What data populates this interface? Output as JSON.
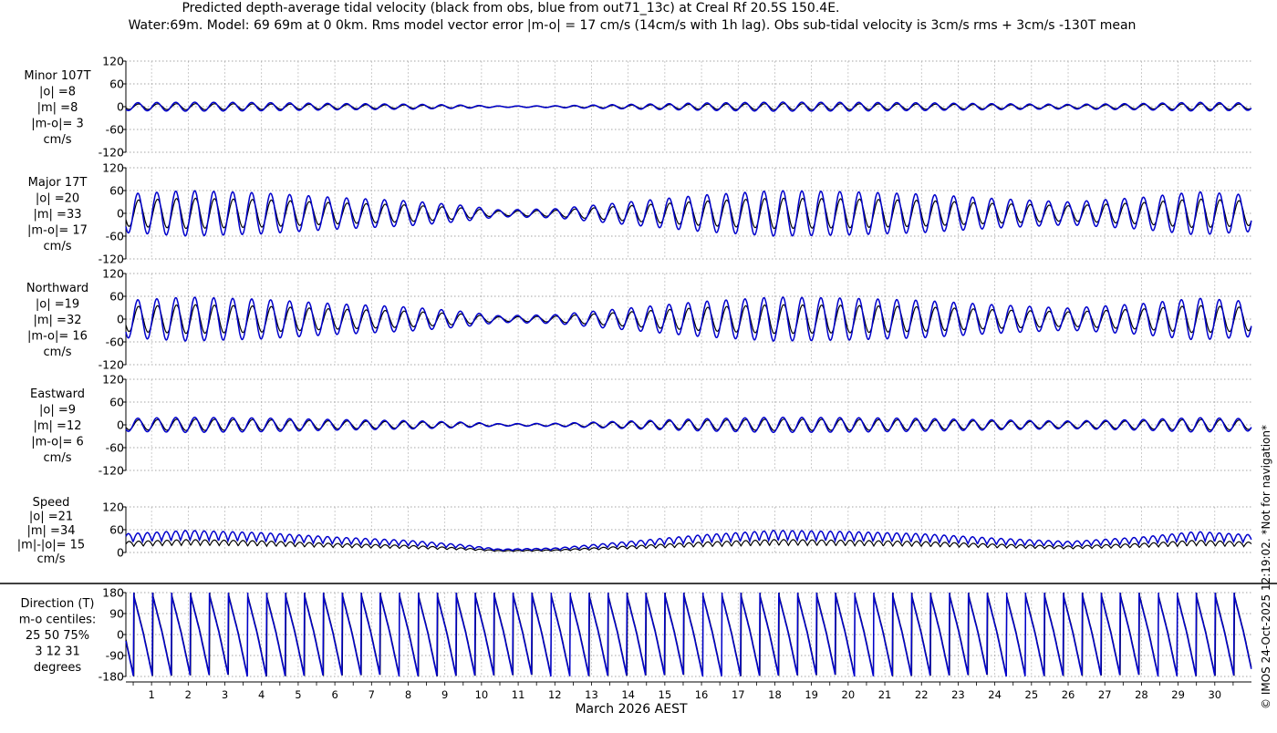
{
  "chart_data": {
    "type": "line",
    "title": "Predicted depth-average tidal velocity (black from obs, blue from out71_13c) at Creal Rf 20.5S 150.4E.",
    "subtitle": "Water:69m. Model: 69 69m at 0 0km. Rms model vector error |m-o| = 17 cm/s (14cm/s with 1h lag). Obs sub-tidal velocity is 3cm/s rms + 3cm/s -130T mean",
    "xlabel": "March 2026 AEST",
    "x_ticks": [
      "1",
      "2",
      "3",
      "4",
      "5",
      "6",
      "7",
      "8",
      "9",
      "10",
      "11",
      "12",
      "13",
      "14",
      "15",
      "16",
      "17",
      "18",
      "19",
      "20",
      "21",
      "22",
      "23",
      "24",
      "25",
      "26",
      "27",
      "28",
      "29",
      "30"
    ],
    "xlim": [
      0.3,
      31.0
    ],
    "grid": true,
    "watermark": "© IMOS 24-Oct-2025 12:19:02. *Not for navigation*",
    "colors": {
      "obs": "#000000",
      "model": "#0000cc"
    },
    "panels": [
      {
        "id": "minor",
        "label_lines": [
          "Minor 107T",
          "|o| =8",
          "|m| =8",
          "|m-o|= 3",
          "cm/s"
        ],
        "ylim": [
          -120,
          120
        ],
        "yticks": [
          "120",
          "60",
          "0",
          "-60",
          "-120"
        ],
        "ytick_values": [
          120,
          60,
          0,
          -60,
          -120
        ],
        "kind": "signed",
        "obs_amplitude": 8,
        "model_amplitude": 12
      },
      {
        "id": "major",
        "label_lines": [
          "Major 17T",
          "|o| =20",
          "|m| =33",
          "|m-o|= 17",
          "cm/s"
        ],
        "ylim": [
          -120,
          120
        ],
        "yticks": [
          "120",
          "60",
          "0",
          "-60",
          "-120"
        ],
        "ytick_values": [
          120,
          60,
          0,
          -60,
          -120
        ],
        "kind": "signed",
        "obs_amplitude": 40,
        "model_amplitude": 60
      },
      {
        "id": "northward",
        "label_lines": [
          "Northward",
          "|o| =19",
          "|m| =32",
          "|m-o|= 16",
          "cm/s"
        ],
        "ylim": [
          -120,
          120
        ],
        "yticks": [
          "120",
          "60",
          "0",
          "-60",
          "-120"
        ],
        "ytick_values": [
          120,
          60,
          0,
          -60,
          -120
        ],
        "kind": "signed",
        "obs_amplitude": 38,
        "model_amplitude": 58
      },
      {
        "id": "eastward",
        "label_lines": [
          "Eastward",
          "|o| =9",
          "|m| =12",
          "|m-o|= 6",
          "cm/s"
        ],
        "ylim": [
          -120,
          120
        ],
        "yticks": [
          "120",
          "60",
          "0",
          "-60",
          "-120"
        ],
        "ytick_values": [
          120,
          60,
          0,
          -60,
          -120
        ],
        "kind": "signed",
        "obs_amplitude": 15,
        "model_amplitude": 20
      },
      {
        "id": "speed",
        "label_lines": [
          "Speed",
          "|o| =21",
          "|m| =34",
          "|m|-|o|= 15",
          "cm/s"
        ],
        "ylim": [
          0,
          120
        ],
        "yticks": [
          "120",
          "60",
          "0"
        ],
        "ytick_values": [
          120,
          60,
          0
        ],
        "kind": "speed",
        "obs_amplitude": 40,
        "model_amplitude": 58
      },
      {
        "id": "direction",
        "label_lines": [
          "Direction (T)",
          "m-o centiles:",
          "25  50  75%",
          "3  12  31",
          "degrees"
        ],
        "ylim": [
          -180,
          180
        ],
        "yticks": [
          "180",
          "90",
          "0",
          "-90",
          "-180"
        ],
        "ytick_values": [
          180,
          90,
          0,
          -90,
          -180
        ],
        "kind": "direction"
      }
    ],
    "series": [
      {
        "name": "obs"
      },
      {
        "name": "out71_13c"
      }
    ],
    "tide_period_days": 0.5175,
    "spring_neap_envelope": {
      "days": [
        0.3,
        2,
        4,
        6,
        8,
        9.5,
        10.5,
        12,
        14,
        16,
        18,
        20,
        22,
        24,
        26,
        28,
        29.5,
        31
      ],
      "factor": [
        0.85,
        1.0,
        0.9,
        0.7,
        0.55,
        0.35,
        0.15,
        0.2,
        0.5,
        0.8,
        1.0,
        0.95,
        0.85,
        0.65,
        0.5,
        0.7,
        0.95,
        0.8
      ]
    }
  }
}
